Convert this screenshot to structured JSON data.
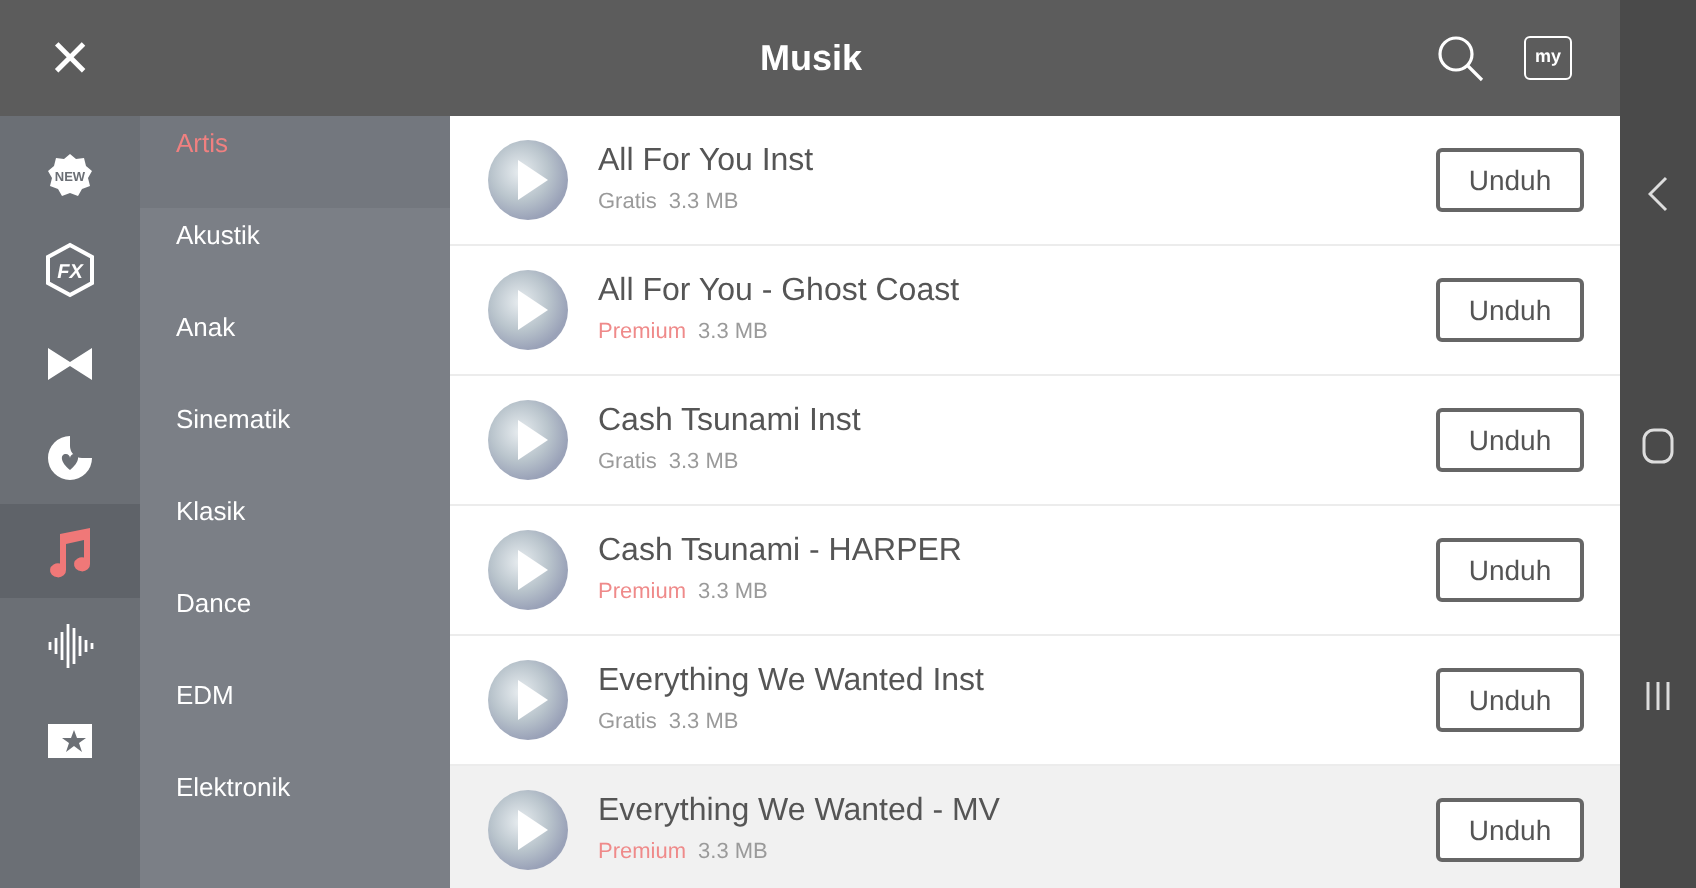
{
  "header": {
    "close": "×",
    "title": "Musik",
    "folder_label": "my"
  },
  "icon_rail": [
    {
      "kind": "new",
      "label": "NEW",
      "selected": false
    },
    {
      "kind": "fx",
      "label": "FX",
      "selected": false
    },
    {
      "kind": "bowtie",
      "selected": false
    },
    {
      "kind": "heart",
      "selected": false
    },
    {
      "kind": "music",
      "selected": true
    },
    {
      "kind": "wave",
      "selected": false
    },
    {
      "kind": "star",
      "selected": false
    }
  ],
  "categories": [
    {
      "label": "Artis",
      "selected": true
    },
    {
      "label": "Akustik",
      "selected": false
    },
    {
      "label": "Anak",
      "selected": false
    },
    {
      "label": "Sinematik",
      "selected": false
    },
    {
      "label": "Klasik",
      "selected": false
    },
    {
      "label": "Dance",
      "selected": false
    },
    {
      "label": "EDM",
      "selected": false
    },
    {
      "label": "Elektronik",
      "selected": false
    }
  ],
  "tracks": [
    {
      "title": "All For You Inst",
      "tier": "Gratis",
      "premium": false,
      "size": "3.3 MB",
      "button": "Unduh",
      "selected": false
    },
    {
      "title": "All For You - Ghost Coast",
      "tier": "Premium",
      "premium": true,
      "size": "3.3 MB",
      "button": "Unduh",
      "selected": false
    },
    {
      "title": "Cash Tsunami Inst",
      "tier": "Gratis",
      "premium": false,
      "size": "3.3 MB",
      "button": "Unduh",
      "selected": false
    },
    {
      "title": "Cash Tsunami - HARPER",
      "tier": "Premium",
      "premium": true,
      "size": "3.3 MB",
      "button": "Unduh",
      "selected": false
    },
    {
      "title": "Everything We Wanted Inst",
      "tier": "Gratis",
      "premium": false,
      "size": "3.3 MB",
      "button": "Unduh",
      "selected": false
    },
    {
      "title": "Everything We Wanted - MV",
      "tier": "Premium",
      "premium": true,
      "size": "3.3 MB",
      "button": "Unduh",
      "selected": true
    }
  ]
}
